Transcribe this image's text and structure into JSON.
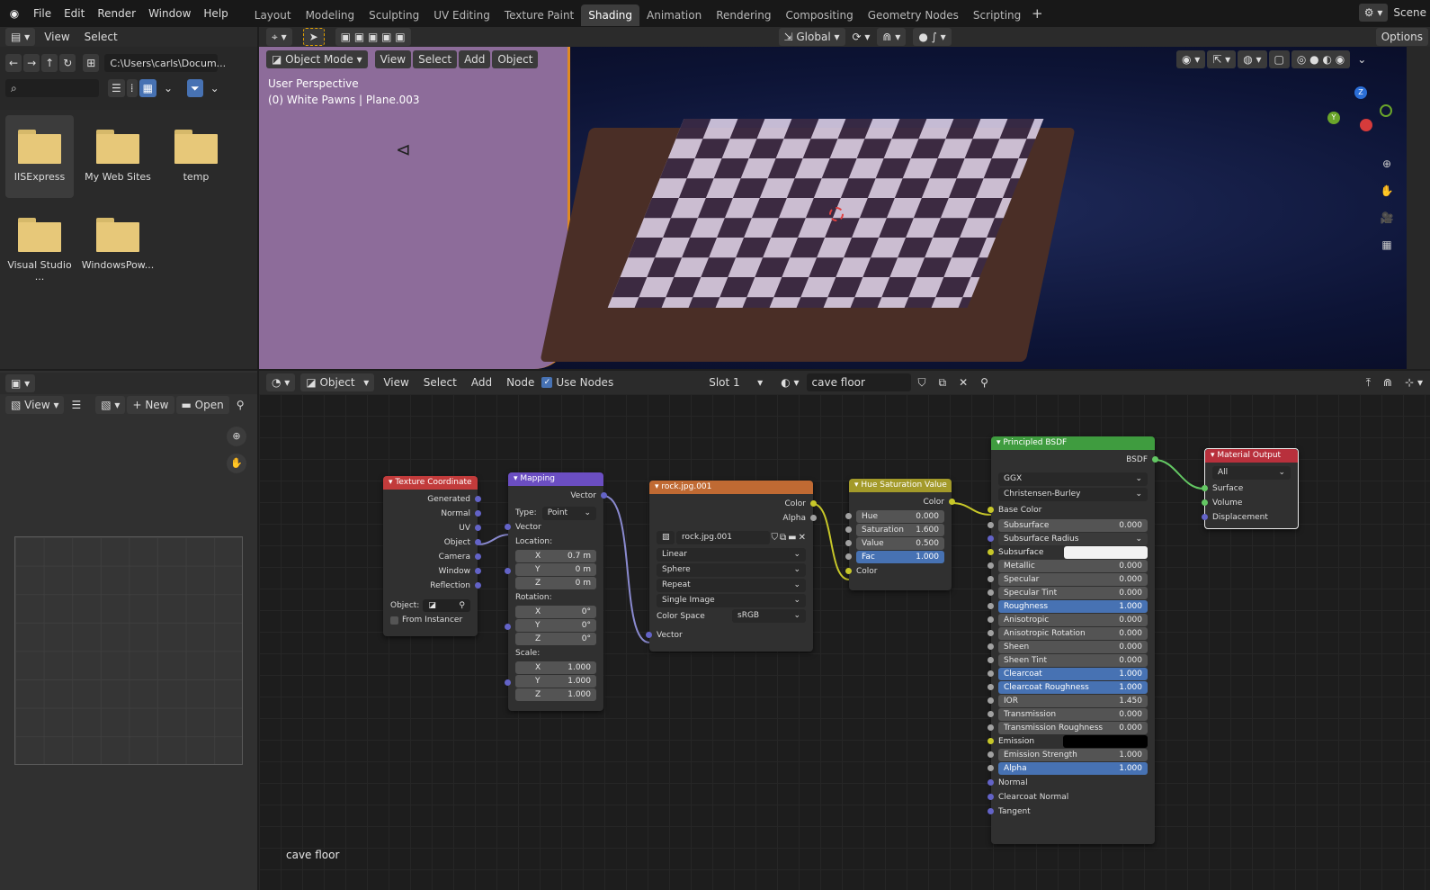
{
  "topbar": {
    "menus": [
      "File",
      "Edit",
      "Render",
      "Window",
      "Help"
    ],
    "workspaces": [
      "Layout",
      "Modeling",
      "Sculpting",
      "UV Editing",
      "Texture Paint",
      "Shading",
      "Animation",
      "Rendering",
      "Compositing",
      "Geometry Nodes",
      "Scripting"
    ],
    "active_workspace": "Shading",
    "scene_label": "Scene"
  },
  "file_browser": {
    "header_menus": [
      "View",
      "Select"
    ],
    "path": "C:\\Users\\carls\\Docum...",
    "items": [
      {
        "name": "IISExpress",
        "selected": true
      },
      {
        "name": "My Web Sites"
      },
      {
        "name": "temp"
      },
      {
        "name": "Visual Studio ..."
      },
      {
        "name": "WindowsPow..."
      }
    ]
  },
  "viewport": {
    "mode": "Object Mode",
    "menus": [
      "View",
      "Select",
      "Add",
      "Object"
    ],
    "orientation": "Global",
    "options": "Options",
    "info_line1": "User Perspective",
    "info_line2": "(0) White Pawns | Plane.003"
  },
  "image_editor": {
    "view": "View",
    "new": "New",
    "open": "Open"
  },
  "node_editor": {
    "type": "Object",
    "menus": [
      "View",
      "Select",
      "Add",
      "Node"
    ],
    "use_nodes": "Use Nodes",
    "slot": "Slot 1",
    "material": "cave floor",
    "footer": "cave floor"
  },
  "nodes": {
    "tex_coord": {
      "title": "Texture Coordinate",
      "outputs": [
        "Generated",
        "Normal",
        "UV",
        "Object",
        "Camera",
        "Window",
        "Reflection"
      ],
      "object_label": "Object:",
      "from_instancer": "From Instancer",
      "color": "#c23b3b"
    },
    "mapping": {
      "title": "Mapping",
      "out": "Vector",
      "type_label": "Type:",
      "type_value": "Point",
      "in": "Vector",
      "location": "Location:",
      "loc": [
        [
          "X",
          "0.7 m"
        ],
        [
          "Y",
          "0 m"
        ],
        [
          "Z",
          "0 m"
        ]
      ],
      "rotation": "Rotation:",
      "rot": [
        [
          "X",
          "0°"
        ],
        [
          "Y",
          "0°"
        ],
        [
          "Z",
          "0°"
        ]
      ],
      "scale": "Scale:",
      "scl": [
        [
          "X",
          "1.000"
        ],
        [
          "Y",
          "1.000"
        ],
        [
          "Z",
          "1.000"
        ]
      ],
      "color": "#6b4ec2"
    },
    "image": {
      "title": "rock.jpg.001",
      "outs": [
        "Color",
        "Alpha"
      ],
      "file": "rock.jpg.001",
      "opts": [
        "Linear",
        "Sphere",
        "Repeat",
        "Single Image"
      ],
      "cs_label": "Color Space",
      "cs_value": "sRGB",
      "in": "Vector",
      "color": "#c06a33"
    },
    "hsv": {
      "title": "Hue Saturation Value",
      "out": "Color",
      "fields": [
        [
          "Hue",
          "0.000"
        ],
        [
          "Saturation",
          "1.600"
        ],
        [
          "Value",
          "0.500"
        ],
        [
          "Fac",
          "1.000"
        ]
      ],
      "in": "Color",
      "color": "#a39a2a"
    },
    "bsdf": {
      "title": "Principled BSDF",
      "out": "BSDF",
      "dist": "GGX",
      "ss_method": "Christensen-Burley",
      "base_color": "Base Color",
      "fields": [
        [
          "Subsurface",
          "0.000"
        ],
        [
          "Subsurface Radius",
          ""
        ],
        [
          "Subsurface Co...",
          ""
        ],
        [
          "Metallic",
          "0.000"
        ],
        [
          "Specular",
          "0.000"
        ],
        [
          "Specular Tint",
          "0.000"
        ],
        [
          "Roughness",
          "1.000"
        ],
        [
          "Anisotropic",
          "0.000"
        ],
        [
          "Anisotropic Rotation",
          "0.000"
        ],
        [
          "Sheen",
          "0.000"
        ],
        [
          "Sheen Tint",
          "0.000"
        ],
        [
          "Clearcoat",
          "1.000"
        ],
        [
          "Clearcoat Roughness",
          "1.000"
        ],
        [
          "IOR",
          "1.450"
        ],
        [
          "Transmission",
          "0.000"
        ],
        [
          "Transmission Roughness",
          "0.000"
        ],
        [
          "Emission",
          ""
        ],
        [
          "Emission Strength",
          "1.000"
        ],
        [
          "Alpha",
          "1.000"
        ]
      ],
      "bottom": [
        "Normal",
        "Clearcoat Normal",
        "Tangent"
      ],
      "color": "#3f9c3f"
    },
    "output": {
      "title": "Material Output",
      "target": "All",
      "inputs": [
        "Surface",
        "Volume",
        "Displacement"
      ],
      "color": "#b8303c"
    }
  }
}
